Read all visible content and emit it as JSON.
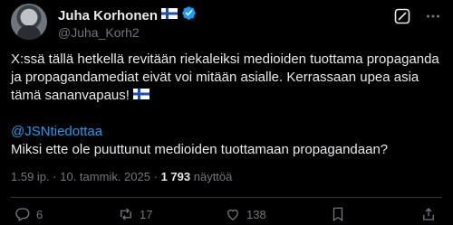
{
  "author": {
    "display_name": "Juha Korhonen",
    "handle": "@Juha_Korh2"
  },
  "tweet": {
    "line1": "X:ssä tällä hetkellä revitään riekaleiksi medioiden tuottama propaganda ja propagandamediat eivät voi mitään asialle. Kerrassaan upea asia tämä sananvapaus!",
    "mention": "@JSNtiedottaa",
    "question": "Miksi ette ole puuttunut medioiden tuottamaan propagandaan?"
  },
  "meta": {
    "time": "1.59 ip.",
    "separator": "·",
    "date": "10. tammik. 2025",
    "views_count": "1 793",
    "views_label": "näyttöä"
  },
  "actions": {
    "replies": "6",
    "reposts": "17",
    "likes": "138"
  },
  "icons": [
    "finland-flag-icon",
    "verified-badge-icon",
    "grok-icon",
    "more-icon",
    "reply-icon",
    "repost-icon",
    "like-icon",
    "bookmark-icon",
    "share-icon"
  ],
  "colors": {
    "background": "#000000",
    "text": "#e7e9ea",
    "secondary": "#71767b",
    "accent": "#1d9bf0"
  }
}
